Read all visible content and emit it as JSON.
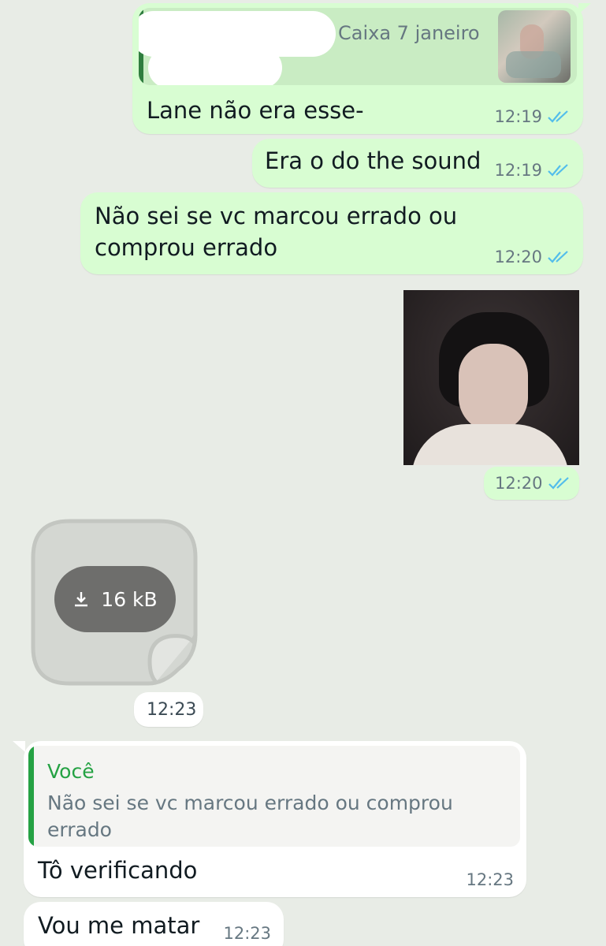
{
  "messages": {
    "m1": {
      "quote_caption": "Caixa 7 janeiro",
      "text": "Lane não era esse-",
      "time": "12:19",
      "status": "read"
    },
    "m2": {
      "text": "Era o do the sound",
      "time": "12:19",
      "status": "read"
    },
    "m3": {
      "line1": "Não sei se vc marcou errado ou",
      "line2": "comprou errado",
      "time": "12:20",
      "status": "read"
    },
    "m4": {
      "image": "photo-of-person",
      "time": "12:20",
      "status": "read"
    },
    "m5": {
      "sticker_download_size": "16 kB",
      "time": "12:23"
    },
    "m6": {
      "quote_author": "Você",
      "quote_line1": "Não sei se vc marcou errado ou comprou",
      "quote_line2": "errado",
      "text": "Tô verificando",
      "time": "12:23"
    },
    "m7": {
      "text": "Vou me matar",
      "time": "12:23"
    }
  },
  "colors": {
    "background": "#e8ece6",
    "outgoing_bubble": "#d8fdd2",
    "incoming_bubble": "#ffffff",
    "quote_accent": "#25a244",
    "read_ticks": "#53bdeb"
  },
  "icons": [
    "double-check-icon",
    "download-icon"
  ]
}
